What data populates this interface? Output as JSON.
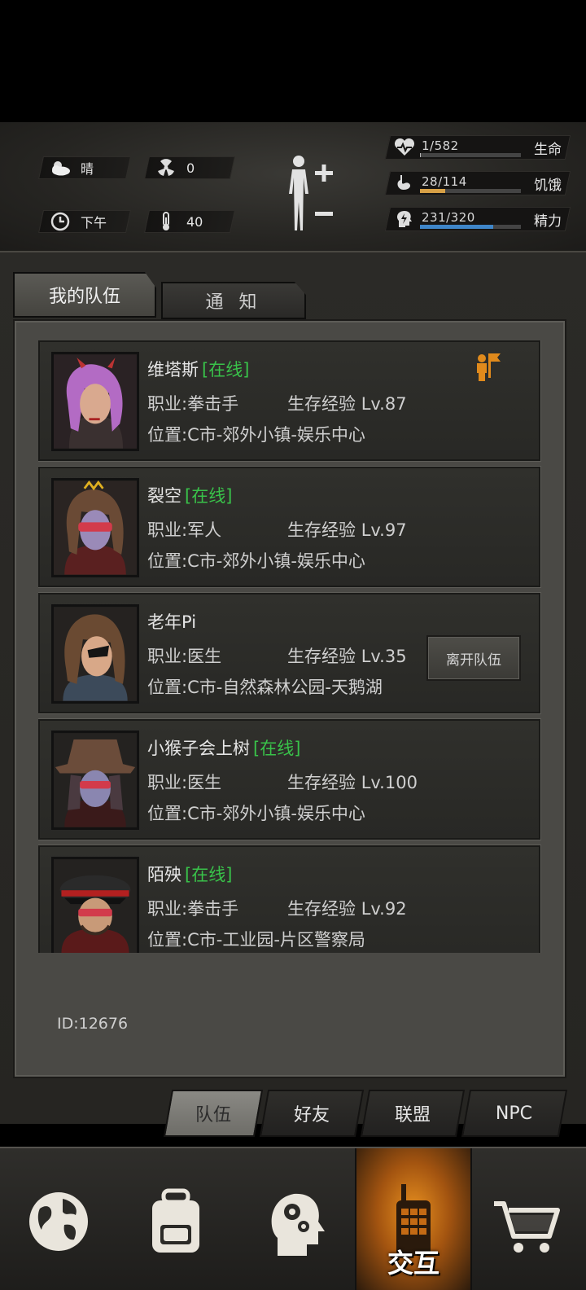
{
  "status": {
    "weather": "晴",
    "radiation": "0",
    "time_of_day": "下午",
    "temperature": "40",
    "health": {
      "value": "1/582",
      "label": "生命",
      "ratio": 0.002,
      "color": "#b7b7b7"
    },
    "hunger": {
      "value": "28/114",
      "label": "饥饿",
      "ratio": 0.246,
      "color": "#d7a046"
    },
    "energy": {
      "value": "231/320",
      "label": "精力",
      "ratio": 0.722,
      "color": "#3f86c9"
    }
  },
  "tabs": {
    "my_team": "我的队伍",
    "notice": "通 知"
  },
  "members": [
    {
      "name": "维塔斯",
      "online": "[在线]",
      "job_label": "职业:",
      "job": "拳击手",
      "exp_label": "生存经验",
      "level": "Lv.87",
      "loc_label": "位置:",
      "location": "C市-郊外小镇-娱乐中心"
    },
    {
      "name": "裂空",
      "online": "[在线]",
      "job_label": "职业:",
      "job": "军人",
      "exp_label": "生存经验",
      "level": "Lv.97",
      "loc_label": "位置:",
      "location": "C市-郊外小镇-娱乐中心"
    },
    {
      "name": "老年Pi",
      "online": "",
      "job_label": "职业:",
      "job": "医生",
      "exp_label": "生存经验",
      "level": "Lv.35",
      "loc_label": "位置:",
      "location": "C市-自然森林公园-天鹅湖"
    },
    {
      "name": "小猴子会上树",
      "online": "[在线]",
      "job_label": "职业:",
      "job": "医生",
      "exp_label": "生存经验",
      "level": "Lv.100",
      "loc_label": "位置:",
      "location": "C市-郊外小镇-娱乐中心"
    },
    {
      "name": "陌殃",
      "online": "[在线]",
      "job_label": "职业:",
      "job": "拳击手",
      "exp_label": "生存经验",
      "level": "Lv.92",
      "loc_label": "位置:",
      "location": "C市-工业园-片区警察局"
    }
  ],
  "leave_button": "离开队伍",
  "player_id": "ID:12676",
  "sub_tabs": [
    "队伍",
    "好友",
    "联盟",
    "NPC"
  ],
  "nav": {
    "active_label": "交互",
    "icons": [
      "globe-icon",
      "backpack-icon",
      "head-gears-icon",
      "walkie-talkie-icon",
      "cart-icon"
    ]
  },
  "colors": {
    "online": "#39c24a",
    "leader": "#e08a1c",
    "accent": "#e8901f"
  }
}
